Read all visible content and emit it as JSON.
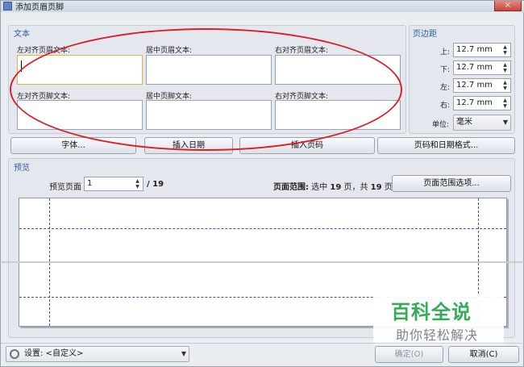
{
  "window": {
    "title": "添加页眉页脚",
    "close_symbol": "×"
  },
  "text_group": {
    "title": "文本",
    "header_left_label": "左对齐页眉文本:",
    "header_center_label": "居中页眉文本:",
    "header_right_label": "右对齐页眉文本:",
    "footer_left_label": "左对齐页脚文本:",
    "footer_center_label": "居中页脚文本:",
    "footer_right_label": "右对齐页脚文本:"
  },
  "margins_group": {
    "title": "页边距",
    "top_label": "上:",
    "top_value": "12.7 mm",
    "bottom_label": "下:",
    "bottom_value": "12.7 mm",
    "left_label": "左:",
    "left_value": "12.7 mm",
    "right_label": "右:",
    "right_value": "12.7 mm",
    "unit_label": "单位:",
    "unit_value": "毫米"
  },
  "toolbar": {
    "font_button": "字体...",
    "insert_date_button": "插入日期",
    "insert_page_button": "插入页码",
    "format_button": "页码和日期格式..."
  },
  "preview_group": {
    "title": "预览",
    "page_label": "预览页面",
    "page_value": "1",
    "page_total": "/ 19",
    "range_prefix": "页面范围:",
    "range_selected_text": " 选中 ",
    "range_selected_count": "19",
    "range_mid_text": " 页，共 ",
    "range_total_count": "19",
    "range_suffix": " 页",
    "range_options_button": "页面范围选项..."
  },
  "footer": {
    "settings_label": "设置:",
    "settings_value": "<自定义>",
    "ok_button": "确定(O)",
    "cancel_button": "取消(C)"
  },
  "watermark": {
    "main": "百科全说",
    "sub": "助你轻松解决"
  },
  "icons": {
    "settings": "gear-icon",
    "spin": "spin-arrows-icon"
  },
  "colors": {
    "annotation": "#d8202a",
    "watermark_green": "#2aa84f",
    "guide": "#3d4f9e"
  }
}
